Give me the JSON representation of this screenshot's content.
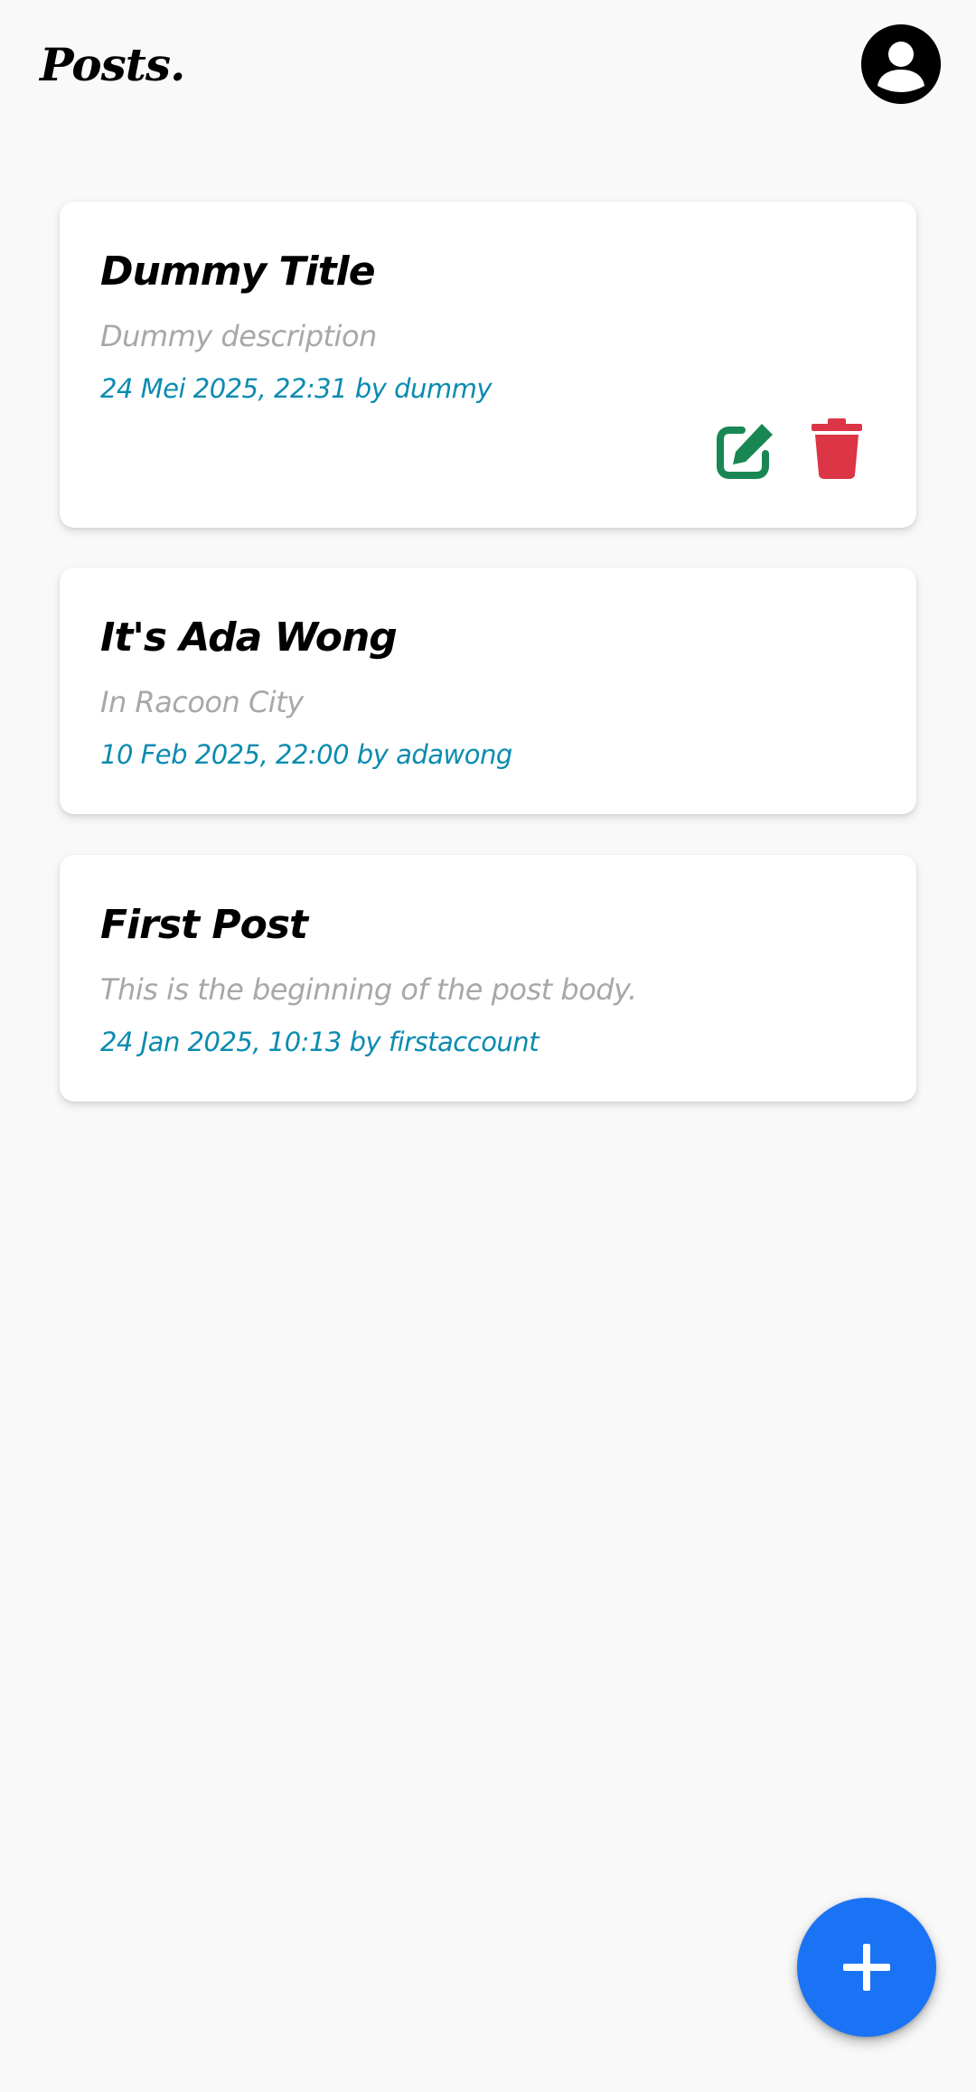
{
  "header": {
    "title": "Posts."
  },
  "posts": [
    {
      "title": "Dummy Title",
      "description": "Dummy description",
      "meta": "24 Mei 2025, 22:31 by dummy",
      "owned": true
    },
    {
      "title": "It's Ada Wong",
      "description": "In Racoon City",
      "meta": "10 Feb 2025, 22:00 by adawong",
      "owned": false
    },
    {
      "title": "First Post",
      "description": "This is the beginning of the post body.",
      "meta": "24 Jan 2025, 10:13 by firstaccount",
      "owned": false
    }
  ],
  "icons": {
    "profile": "account-circle-icon",
    "edit": "edit-icon",
    "delete": "trash-icon",
    "add": "plus-icon"
  },
  "colors": {
    "background": "#f9f9f9",
    "meta_text": "#0b8bb0",
    "description_text": "#a8a8a8",
    "edit_icon": "#198754",
    "delete_icon": "#dc3545",
    "fab": "#1a73f5"
  }
}
